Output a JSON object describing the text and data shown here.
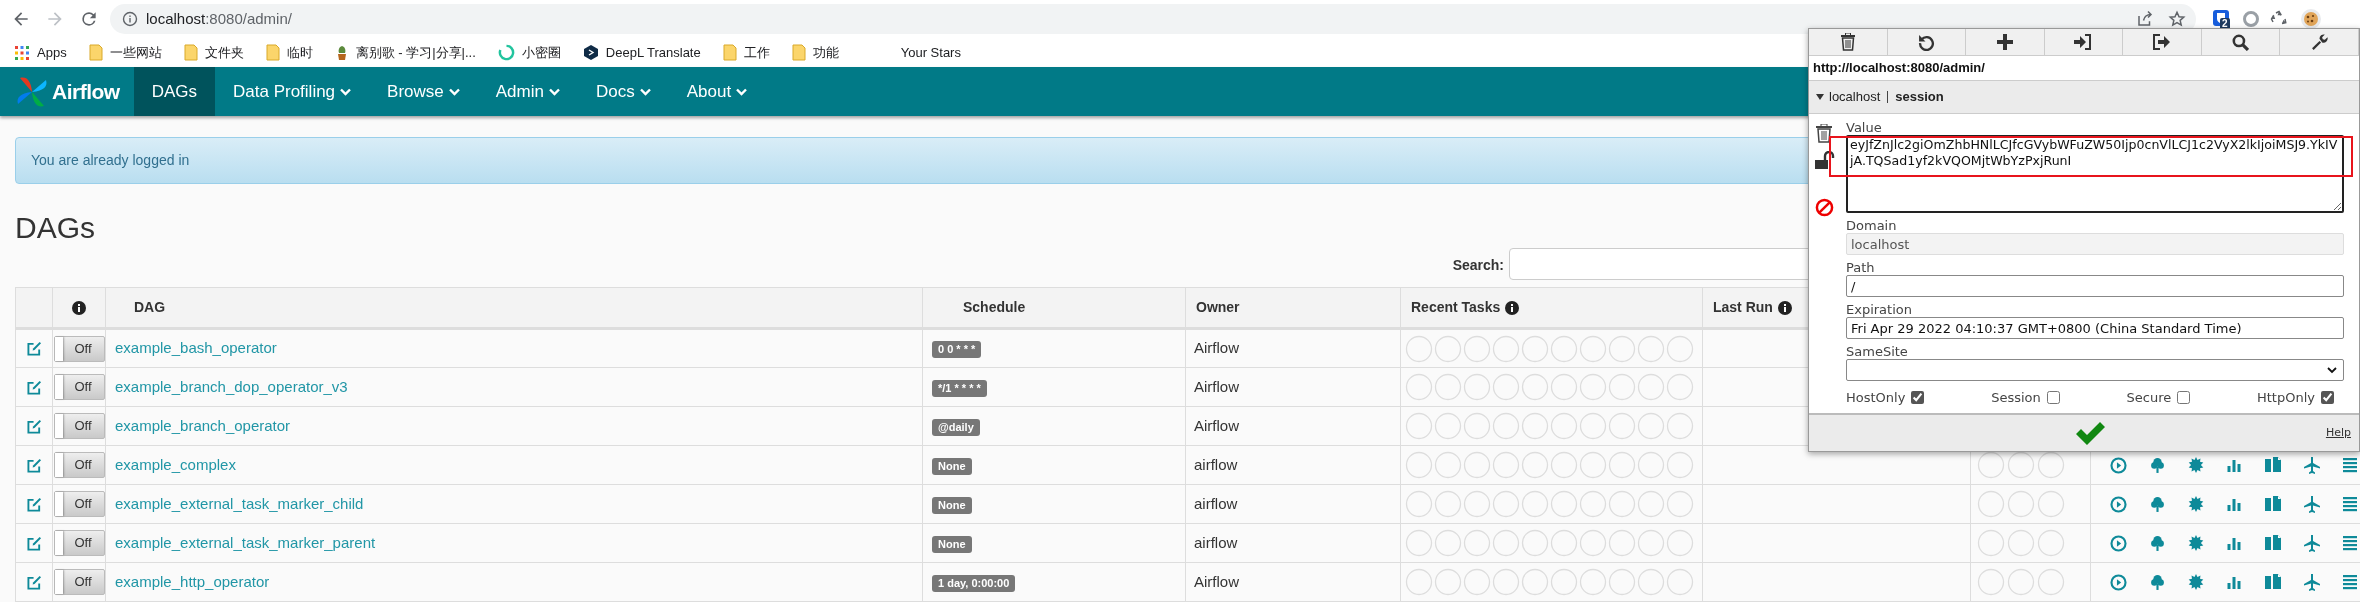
{
  "browser": {
    "url_host": "localhost",
    "url_rest": ":8080/admin/",
    "extension_badge": "2"
  },
  "bookmarks": [
    {
      "label": "Apps",
      "kind": "apps"
    },
    {
      "label": "一些网站",
      "kind": "folder"
    },
    {
      "label": "文件夹",
      "kind": "folder"
    },
    {
      "label": "临时",
      "kind": "folder"
    },
    {
      "label": "离别歌 - 学习|分享|...",
      "kind": "plant"
    },
    {
      "label": "小密圈",
      "kind": "ring"
    },
    {
      "label": "DeepL Translate",
      "kind": "deepl"
    },
    {
      "label": "工作",
      "kind": "folder"
    },
    {
      "label": "功能",
      "kind": "folder"
    },
    {
      "label": "Your Stars",
      "kind": "plain"
    }
  ],
  "navbar": {
    "brand": "Airflow",
    "items": [
      {
        "label": "DAGs",
        "selected": true,
        "dropdown": false
      },
      {
        "label": "Data Profiling",
        "selected": false,
        "dropdown": true
      },
      {
        "label": "Browse",
        "selected": false,
        "dropdown": true
      },
      {
        "label": "Admin",
        "selected": false,
        "dropdown": true
      },
      {
        "label": "Docs",
        "selected": false,
        "dropdown": true
      },
      {
        "label": "About",
        "selected": false,
        "dropdown": true
      }
    ]
  },
  "alert": "You are already logged in",
  "heading": "DAGs",
  "search": {
    "label": "Search:"
  },
  "table": {
    "columns": [
      {
        "label": "DAG",
        "info": false
      },
      {
        "label": "Schedule",
        "info": false
      },
      {
        "label": "Owner",
        "info": false
      },
      {
        "label": "Recent Tasks",
        "info": true
      },
      {
        "label": "Last Run",
        "info": true
      }
    ],
    "rows": [
      {
        "dag": "example_bash_operator",
        "on": false,
        "toggle": "Off",
        "schedule": "0 0 * * *",
        "owner": "Airflow"
      },
      {
        "dag": "example_branch_dop_operator_v3",
        "on": false,
        "toggle": "Off",
        "schedule": "*/1 * * * *",
        "owner": "Airflow"
      },
      {
        "dag": "example_branch_operator",
        "on": false,
        "toggle": "Off",
        "schedule": "@daily",
        "owner": "Airflow"
      },
      {
        "dag": "example_complex",
        "on": false,
        "toggle": "Off",
        "schedule": "None",
        "owner": "airflow"
      },
      {
        "dag": "example_external_task_marker_child",
        "on": false,
        "toggle": "Off",
        "schedule": "None",
        "owner": "airflow"
      },
      {
        "dag": "example_external_task_marker_parent",
        "on": false,
        "toggle": "Off",
        "schedule": "None",
        "owner": "airflow"
      },
      {
        "dag": "example_http_operator",
        "on": false,
        "toggle": "Off",
        "schedule": "1 day, 0:00:00",
        "owner": "Airflow"
      }
    ]
  },
  "cookie_editor": {
    "url": "http://localhost:8080/admin/",
    "cookie_domain": "localhost",
    "cookie_name": "session",
    "expanded": true,
    "value_label": "Value",
    "value": "eyJfZnJlc2giOmZhbHNlLCJfcGVybWFuZW50Ijp0cnVlLCJ1c2VyX2lkIjoiMSJ9.YkIVjA.TQSad1yf2kVQOMjtWbYzPxjRunI",
    "domain_label": "Domain",
    "domain": "localhost",
    "path_label": "Path",
    "path": "/",
    "expiration_label": "Expiration",
    "expiration": "Fri Apr 29 2022 04:10:37 GMT+0800 (China Standard Time)",
    "samesite_label": "SameSite",
    "flags": [
      {
        "label": "HostOnly",
        "checked": true
      },
      {
        "label": "Session",
        "checked": false
      },
      {
        "label": "Secure",
        "checked": false
      },
      {
        "label": "HttpOnly",
        "checked": true
      }
    ],
    "help": "Help"
  }
}
